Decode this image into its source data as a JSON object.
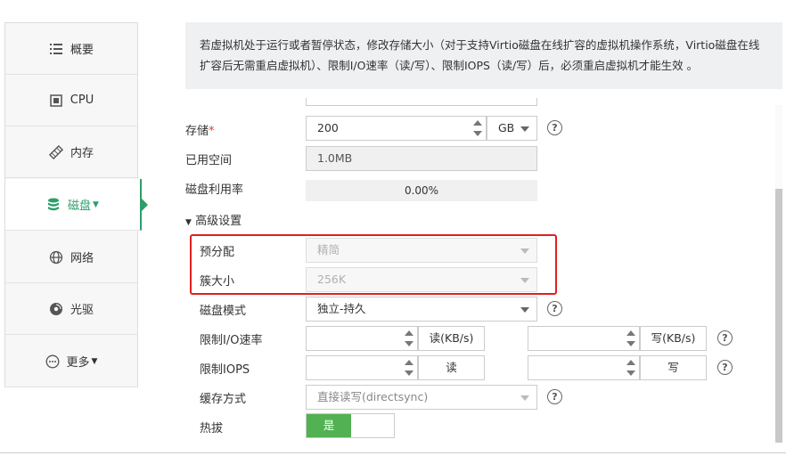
{
  "sidebar": {
    "items": [
      {
        "label": "概要",
        "icon": "list-icon"
      },
      {
        "label": "CPU",
        "icon": "chip-icon"
      },
      {
        "label": "内存",
        "icon": "memory-icon"
      },
      {
        "label": "磁盘",
        "icon": "database-icon",
        "active": true
      },
      {
        "label": "网络",
        "icon": "globe-icon"
      },
      {
        "label": "光驱",
        "icon": "disc-icon"
      },
      {
        "label": "更多",
        "icon": "more-icon"
      }
    ],
    "active_color": "#2e9e6a"
  },
  "notice": "若虚拟机处于运行或者暂停状态，修改存储大小（对于支持Virtio磁盘在线扩容的虚拟机操作系统，Virtio磁盘在线扩容后无需重启虚拟机）、限制I/O速率（读/写）、限制IOPS（读/写）后，必须重启虚拟机才能生效 。",
  "form": {
    "storage": {
      "label": "存储",
      "required_mark": "*",
      "value": "200",
      "unit": "GB"
    },
    "used_space": {
      "label": "已用空间",
      "value": "1.0MB"
    },
    "usage_rate": {
      "label": "磁盘利用率",
      "value": "0.00%"
    },
    "advanced": {
      "label": "高级设置"
    },
    "prealloc": {
      "label": "预分配",
      "value": "精简"
    },
    "cluster_size": {
      "label": "簇大小",
      "value": "256K"
    },
    "disk_mode": {
      "label": "磁盘模式",
      "value": "独立-持久"
    },
    "io_rate": {
      "label": "限制I/O速率",
      "read_unit": "读(KB/s)",
      "write_unit": "写(KB/s)"
    },
    "iops": {
      "label": "限制IOPS",
      "read_unit": "读",
      "write_unit": "写"
    },
    "cache": {
      "label": "缓存方式",
      "value": "直接读写(directsync)"
    },
    "hotplug": {
      "label": "热拔",
      "on_label": "是"
    }
  },
  "help_glyph": "?",
  "highlight_color": "#e02020"
}
